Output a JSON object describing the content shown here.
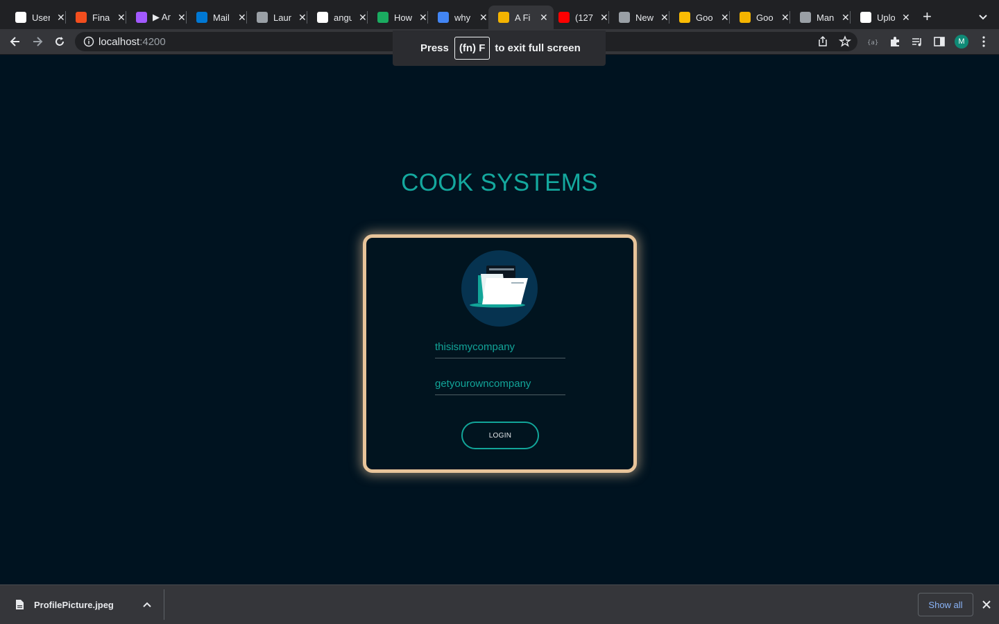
{
  "browser": {
    "tabs": [
      {
        "title": "User",
        "icon": "github-icon",
        "color": "#ffffff"
      },
      {
        "title": "Final",
        "icon": "figma-icon",
        "color": "#f24e1e"
      },
      {
        "title": "▶ Ar",
        "icon": "figma-icon",
        "color": "#a259ff"
      },
      {
        "title": "Mail",
        "icon": "outlook-icon",
        "color": "#0078d4"
      },
      {
        "title": "Laun",
        "icon": "globe-icon",
        "color": "#9aa0a6"
      },
      {
        "title": "angu",
        "icon": "github-icon",
        "color": "#ffffff"
      },
      {
        "title": "How",
        "icon": "w-icon",
        "color": "#1aab60"
      },
      {
        "title": "why",
        "icon": "google-icon",
        "color": "#4285f4"
      },
      {
        "title": "A Fi",
        "icon": "app-icon",
        "color": "#f4b400",
        "active": true
      },
      {
        "title": "(127",
        "icon": "youtube-icon",
        "color": "#ff0000"
      },
      {
        "title": "New",
        "icon": "chrome-icon",
        "color": "#9aa0a6"
      },
      {
        "title": "Goo",
        "icon": "google-doc-icon",
        "color": "#fbbc04"
      },
      {
        "title": "Goo",
        "icon": "google-slides-icon",
        "color": "#f4b400"
      },
      {
        "title": "Man",
        "icon": "globe-icon",
        "color": "#9aa0a6"
      },
      {
        "title": "Uplo",
        "icon": "github-icon",
        "color": "#ffffff"
      }
    ],
    "url_host": "localhost",
    "url_port": ":4200",
    "avatar_initial": "M",
    "fullscreen_notice": {
      "press": "Press",
      "key": "(fn) F",
      "rest": "to exit full screen"
    }
  },
  "page": {
    "brand": "COOK SYSTEMS",
    "username_value": "thisismycompany",
    "password_value": "getyourowncompany",
    "login_label": "LOGIN",
    "colors": {
      "accent": "#12a599",
      "card_border": "#e8c49a",
      "background": "#001320"
    }
  },
  "downloads": {
    "file_name": "ProfilePicture.jpeg",
    "show_all": "Show all"
  }
}
